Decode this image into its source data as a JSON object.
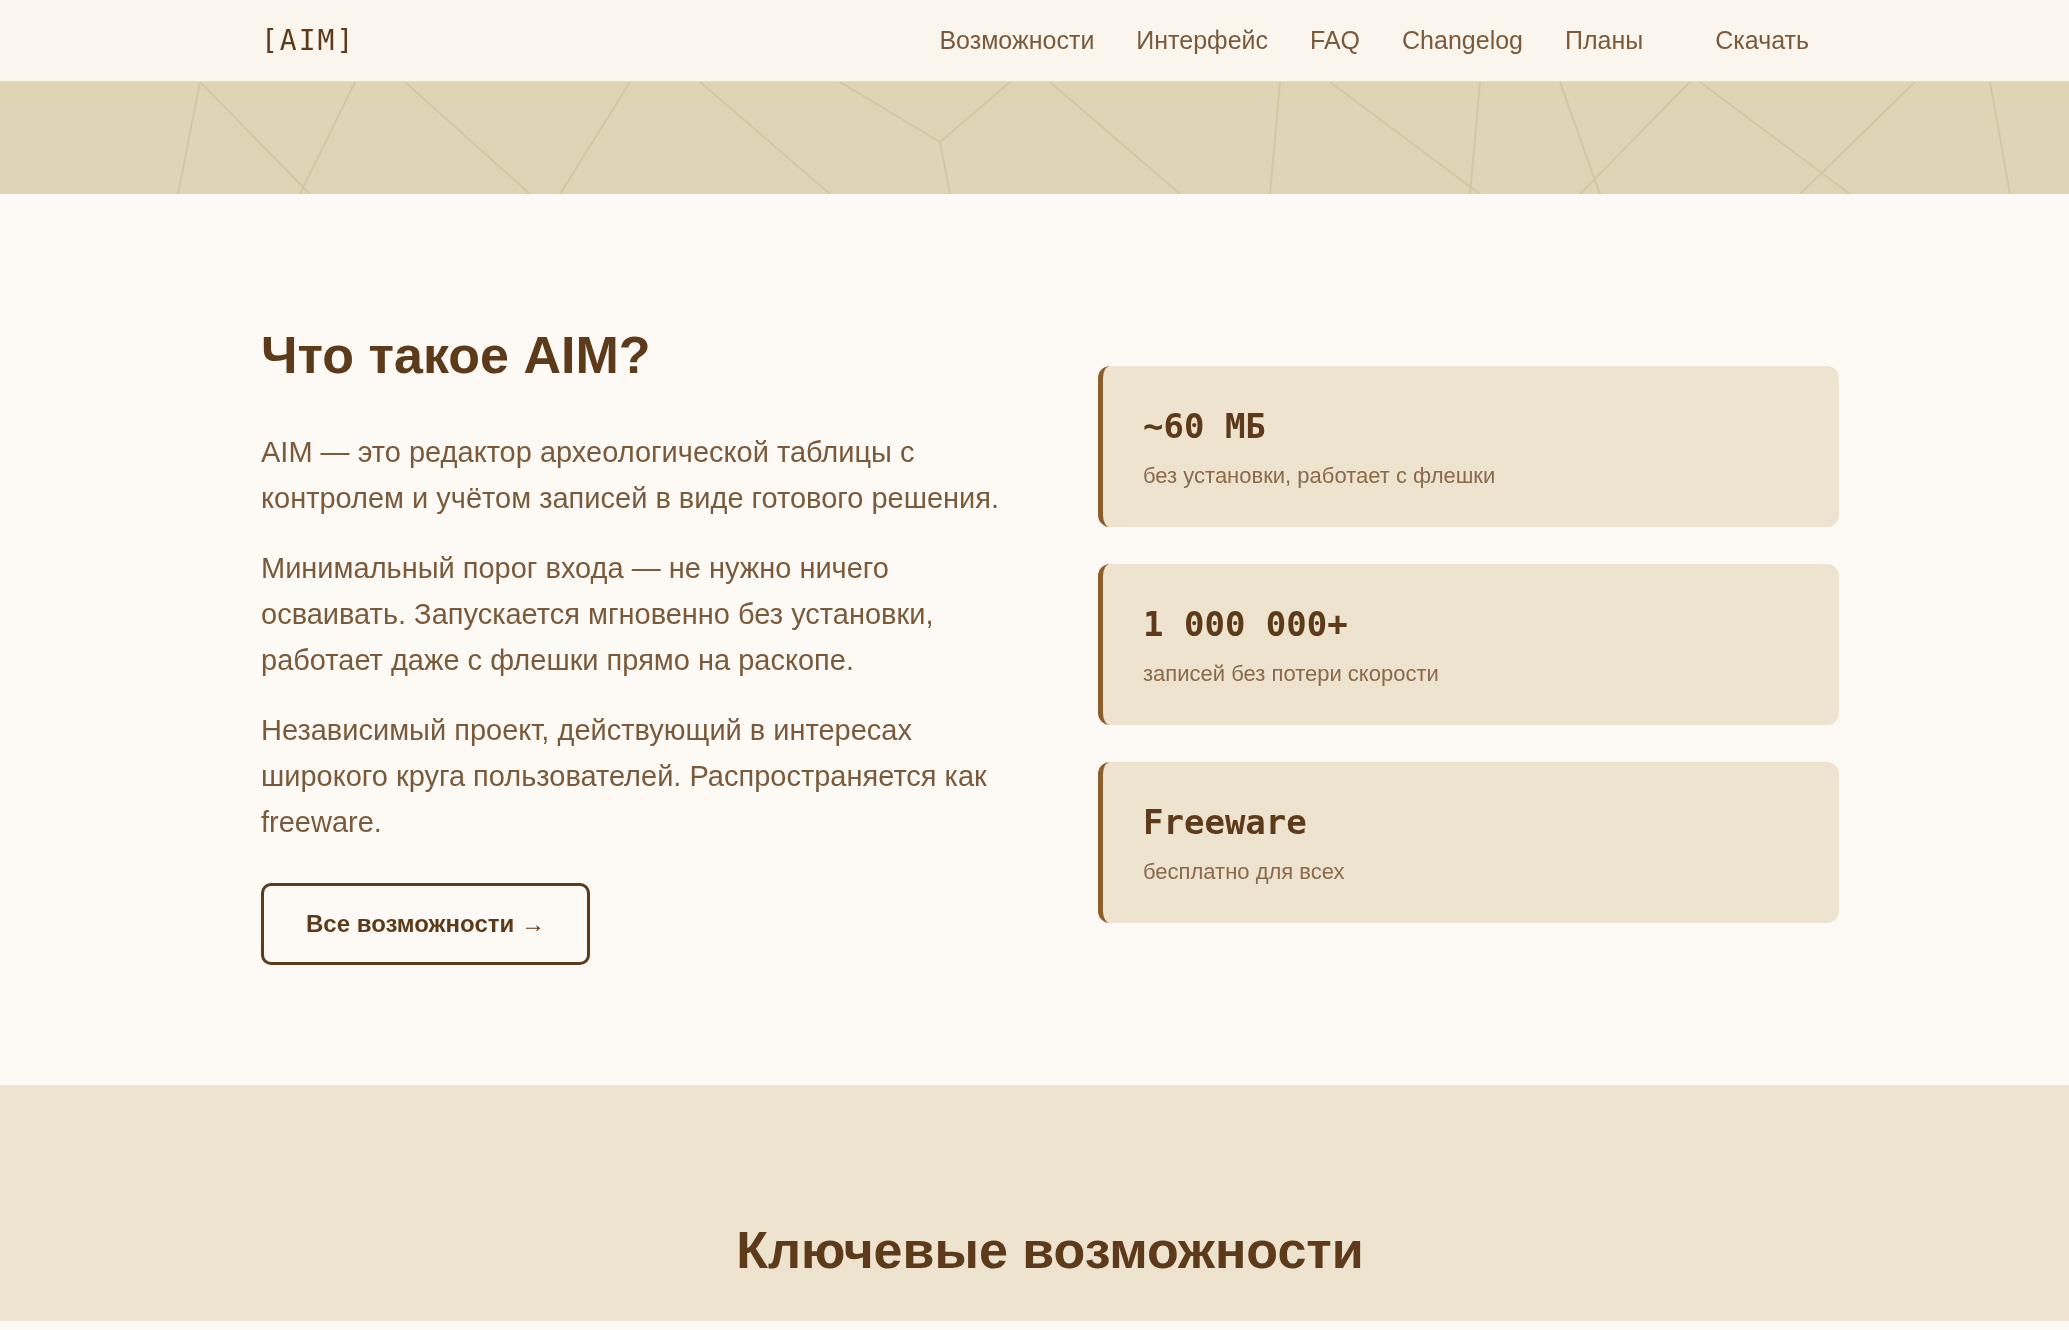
{
  "header": {
    "logo": "[AIM]",
    "nav": [
      "Возможности",
      "Интерфейс",
      "FAQ",
      "Changelog",
      "Планы"
    ],
    "download": "Скачать"
  },
  "about": {
    "title": "Что такое AIM?",
    "paragraphs": [
      "AIM — это редактор археологической таблицы с контролем и учётом записей в виде готового решения.",
      "Минимальный порог входа — не нужно ничего осваивать. Запускается мгновенно без установки, работает даже с флешки прямо на раскопе.",
      "Независимый проект, действующий в интересах широкого круга пользователей. Распространяется как freeware."
    ],
    "button": "Все возможности →",
    "stats": [
      {
        "value": "~60 МБ",
        "label": "без установки, работает с флешки"
      },
      {
        "value": "1 000 000+",
        "label": "записей без потери скорости"
      },
      {
        "value": "Freeware",
        "label": "бесплатно для всех"
      }
    ]
  },
  "features": {
    "title": "Ключевые возможности"
  }
}
